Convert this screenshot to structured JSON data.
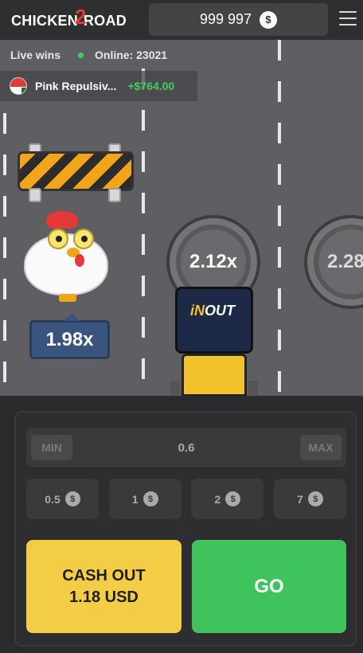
{
  "header": {
    "logo_left": "CHICKEN",
    "logo_num": "2",
    "logo_right": "ROAD",
    "balance": "999 997",
    "currency_symbol": "$"
  },
  "live": {
    "live_wins_label": "Live wins",
    "online_label": "Online: 23021"
  },
  "last_win": {
    "player": "Pink Repulsiv...",
    "amount": "+$764.00"
  },
  "road": {
    "current_multiplier": "1.98x",
    "next_multipliers": [
      "2.12x",
      "2.28x"
    ],
    "truck_brand_a": "iN",
    "truck_brand_b": "OUT"
  },
  "bet": {
    "min_label": "MIN",
    "max_label": "MAX",
    "value": "0.6",
    "quick_amounts": [
      "0.5",
      "1",
      "2",
      "7"
    ]
  },
  "actions": {
    "cashout_line1": "CASH OUT",
    "cashout_line2": "1.18 USD",
    "go_label": "GO"
  },
  "colors": {
    "go": "#3fc35c",
    "cashout": "#f4cd46",
    "win_amount": "#3fd05a",
    "multiplier_tag": "#39557e"
  }
}
